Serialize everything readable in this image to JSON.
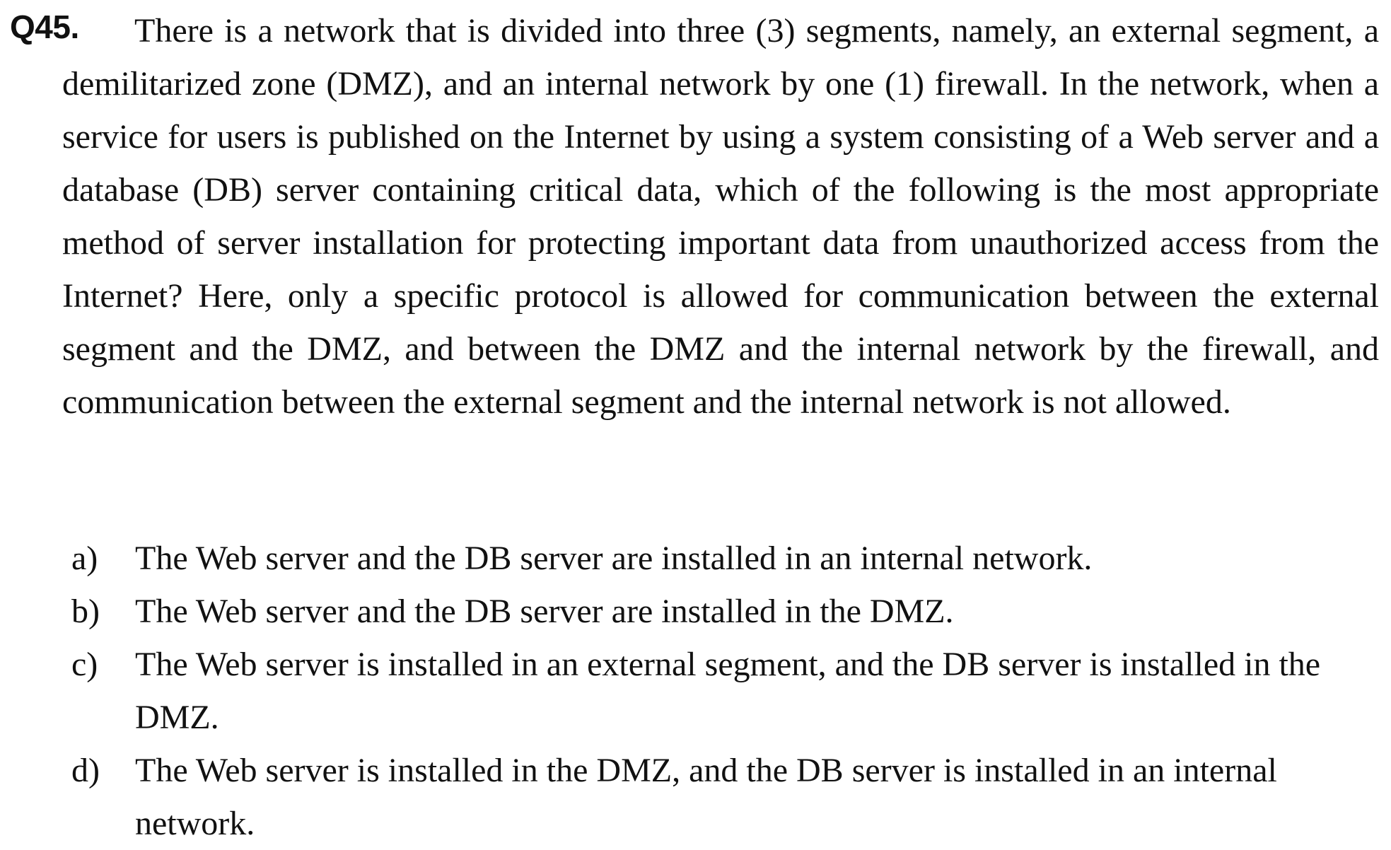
{
  "question": {
    "number": "Q45.",
    "stem": "There is a network that is divided into three (3) segments, namely, an external segment, a demilitarized zone (DMZ), and an internal network by one (1) firewall. In the network, when a service for users is published on the Internet by using a system consisting of a Web server and a database (DB) server containing critical data, which of the following is the most appropriate method of server installation for protecting important data from unauthorized access from the Internet? Here, only a specific protocol is allowed for communication between the external segment and the DMZ, and between the DMZ and the internal network by the firewall, and communication between the external segment and the internal network is not allowed."
  },
  "options": [
    {
      "letter": "a)",
      "text": "The Web server and the DB server are installed in an internal network."
    },
    {
      "letter": "b)",
      "text": "The Web server and the DB server are installed in the DMZ."
    },
    {
      "letter": "c)",
      "text": "The Web server is installed in an external segment, and the DB server is installed in the DMZ."
    },
    {
      "letter": "d)",
      "text": "The Web server is installed in the DMZ, and the DB server is installed in an internal network."
    }
  ]
}
